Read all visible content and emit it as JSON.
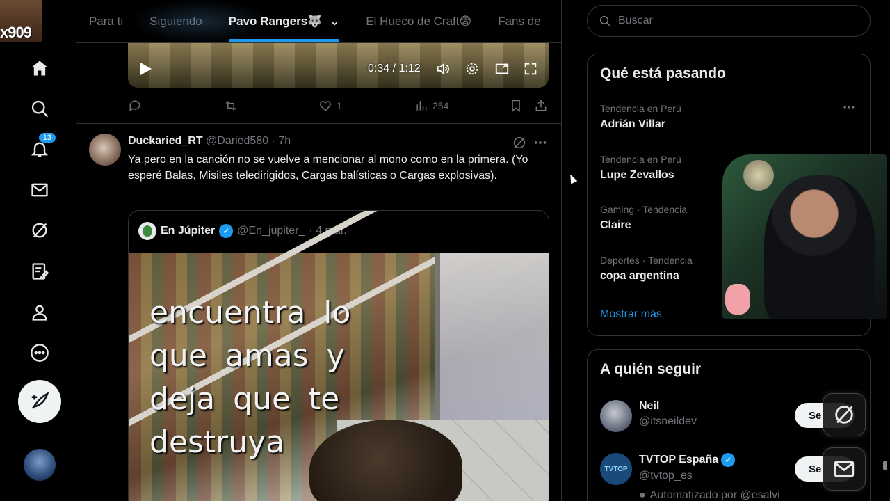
{
  "tabs": [
    {
      "label": "Para ti"
    },
    {
      "label": "Siguiendo"
    },
    {
      "label": "Pavo Rangers🐺"
    },
    {
      "label": "El Hueco de Craft😨"
    },
    {
      "label": "Fans de"
    }
  ],
  "streamer_overlay": {
    "tag": "x909"
  },
  "nav": {
    "notifications_badge": "13"
  },
  "video": {
    "time": "0:34 / 1:12"
  },
  "prev_tweet_actions": {
    "likes": "1",
    "views": "254"
  },
  "tweet": {
    "name": "Duckaried_RT",
    "handle": "@Daried580",
    "time": "· 7h",
    "text": "Ya pero en la canción no se vuelve a mencionar al mono como en la primera. (Yo esperé Balas, Misiles teledirigidos, Cargas balísticas o Cargas explosivas).",
    "quote": {
      "name": "En Júpiter",
      "handle": "@En_jupiter_",
      "date": "· 4 mar.",
      "image_text": "encuentra lo que amas y deja que te destruya"
    }
  },
  "search": {
    "placeholder": "Buscar"
  },
  "trending": {
    "title": "Qué está pasando",
    "items": [
      {
        "context": "Tendencia en Perú",
        "title": "Adrián Villar"
      },
      {
        "context": "Tendencia en Perú",
        "title": "Lupe Zevallos"
      },
      {
        "context": "Gaming · Tendencia",
        "title": "Claire"
      },
      {
        "context": "Deportes · Tendencia",
        "title": "copa argentina"
      }
    ],
    "show_more": "Mostrar más"
  },
  "who_to_follow": {
    "title": "A quién seguir",
    "items": [
      {
        "name": "Neil",
        "handle": "@itsneildev",
        "button": "Se",
        "verified": false
      },
      {
        "name": "TVTOP España",
        "handle": "@tvtop_es",
        "button": "Se",
        "verified": true,
        "avatar_text": "TVTOP"
      }
    ],
    "automation_note": "Automatizado por @esalvi"
  },
  "colors": {
    "accent": "#1d9bf0",
    "background": "#000000",
    "border": "#2f3336",
    "muted": "#71767b"
  }
}
